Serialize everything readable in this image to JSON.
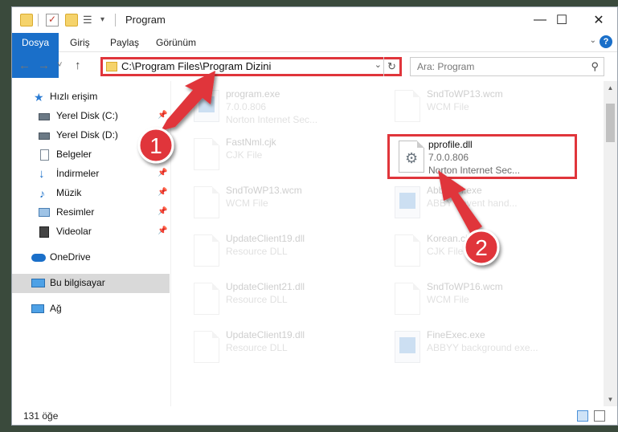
{
  "window": {
    "title": "Program",
    "min_glyph": "—",
    "max_glyph": "☐",
    "close_glyph": "✕"
  },
  "ribbon": {
    "tabs": [
      "Dosya",
      "Giriş",
      "Paylaş",
      "Görünüm"
    ],
    "accent": "#1a6fc9",
    "expand_glyph": "⌄",
    "help_glyph": "?"
  },
  "address": {
    "path": "C:\\Program Files\\Program Dizini",
    "back_glyph": "←",
    "forward_glyph": "→",
    "recent_glyph": "˅",
    "up_glyph": "↑",
    "dropdown_glyph": "⌄",
    "refresh_glyph": "↻"
  },
  "search": {
    "placeholder": "Ara: Program",
    "icon": "search-icon",
    "icon_glyph": "⚲"
  },
  "sidebar": {
    "items": [
      {
        "label": "Hızlı erişim",
        "icon": "star-icon",
        "pinned": false
      },
      {
        "label": "Yerel Disk (C:)",
        "icon": "drive-icon",
        "pinned": true
      },
      {
        "label": "Yerel Disk (D:)",
        "icon": "drive-icon",
        "pinned": true
      },
      {
        "label": "Belgeler",
        "icon": "documents-icon",
        "pinned": true
      },
      {
        "label": "İndirmeler",
        "icon": "download-icon",
        "pinned": true
      },
      {
        "label": "Müzik",
        "icon": "music-icon",
        "pinned": true
      },
      {
        "label": "Resimler",
        "icon": "pictures-icon",
        "pinned": true
      },
      {
        "label": "Videolar",
        "icon": "videos-icon",
        "pinned": true
      },
      {
        "label": "OneDrive",
        "icon": "cloud-icon",
        "pinned": false
      },
      {
        "label": "Bu bilgisayar",
        "icon": "computer-icon",
        "pinned": false,
        "selected": true
      },
      {
        "label": "Ağ",
        "icon": "network-icon",
        "pinned": false
      }
    ],
    "pin_glyph": "📌"
  },
  "files": [
    {
      "name": "program.exe",
      "line1": "7.0.0.806",
      "line2": "Norton Internet Sec...",
      "type": "app"
    },
    {
      "name": "SndToWP13.wcm",
      "line1": "WCM File",
      "line2": "",
      "type": "doc"
    },
    {
      "name": "FastNml.cjk",
      "line1": "CJK File",
      "line2": "",
      "type": "doc"
    },
    {
      "name": "pprofile.dll",
      "line1": "7.0.0.806",
      "line2": "Norton Internet Sec...",
      "type": "dll",
      "highlight": true
    },
    {
      "name": "SndToWP13.wcm",
      "line1": "WCM File",
      "line2": "",
      "type": "doc"
    },
    {
      "name": "AbbySTI.exe",
      "line1": "ABBYY event hand...",
      "line2": "",
      "type": "app"
    },
    {
      "name": "UpdateClient19.dll",
      "line1": "Resource DLL",
      "line2": "",
      "type": "doc"
    },
    {
      "name": "Korean.cjk",
      "line1": "CJK File",
      "line2": "",
      "type": "doc"
    },
    {
      "name": "UpdateClient21.dll",
      "line1": "Resource DLL",
      "line2": "",
      "type": "doc"
    },
    {
      "name": "SndToWP16.wcm",
      "line1": "WCM File",
      "line2": "",
      "type": "doc"
    },
    {
      "name": "UpdateClient19.dll",
      "line1": "Resource DLL",
      "line2": "",
      "type": "doc"
    },
    {
      "name": "FineExec.exe",
      "line1": "ABBYY background exe...",
      "line2": "",
      "type": "app"
    }
  ],
  "status": {
    "count_text": "131 öğe"
  },
  "annotations": [
    {
      "number": "1"
    },
    {
      "number": "2"
    }
  ],
  "colors": {
    "highlight_red": "#e0353b",
    "selection_gray": "#d9d9d9"
  }
}
